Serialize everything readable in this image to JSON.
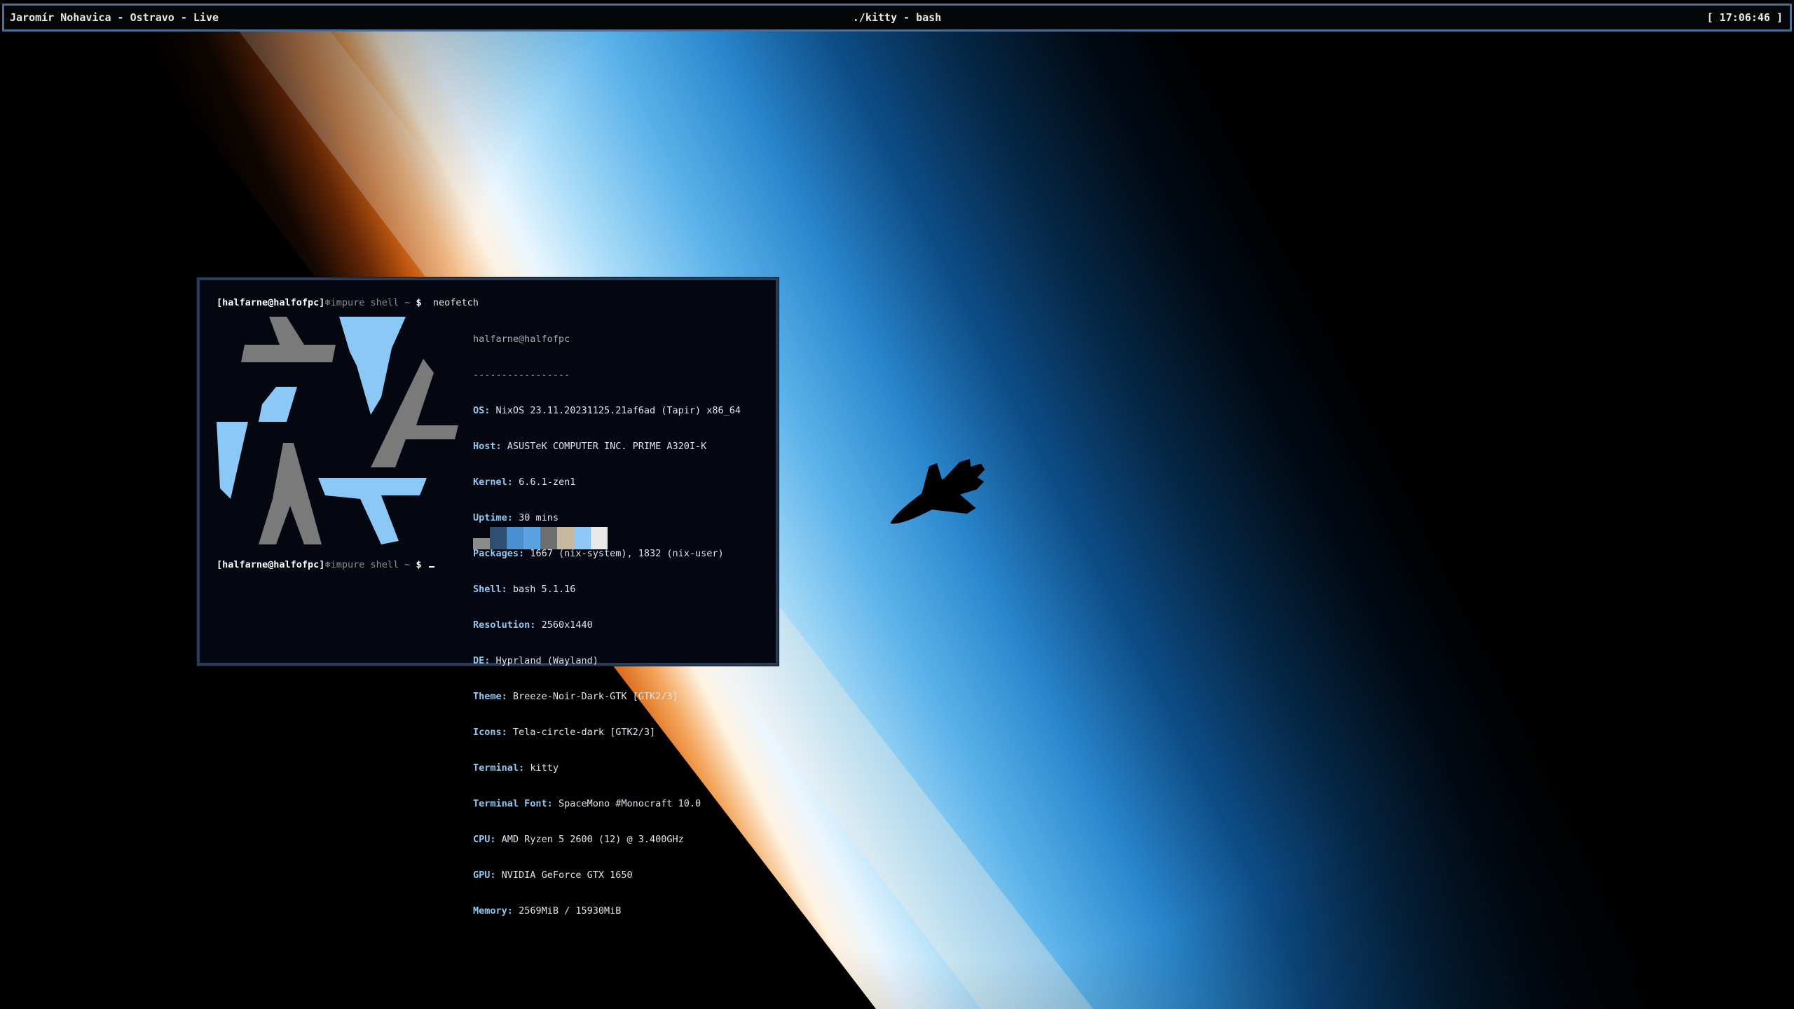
{
  "topbar": {
    "media": "Jaromír Nohavica - Ostravo - Live",
    "window_title": "./kitty - bash",
    "clock": "[ 17:06:46 ]"
  },
  "terminal": {
    "prompt1": {
      "user": "[halfarne@halfofpc]",
      "shell": "❄impure shell ~",
      "dollar": "$",
      "command": "neofetch"
    },
    "prompt2": {
      "user": "[halfarne@halfofpc]",
      "shell": "❄impure shell ~",
      "dollar": "$"
    },
    "neofetch": {
      "title": "halfarne@halfofpc",
      "separator": "-----------------",
      "fields": [
        {
          "key": "OS",
          "value": "NixOS 23.11.20231125.21af6ad (Tapir) x86_64"
        },
        {
          "key": "Host",
          "value": "ASUSTeK COMPUTER INC. PRIME A320I-K"
        },
        {
          "key": "Kernel",
          "value": "6.6.1-zen1"
        },
        {
          "key": "Uptime",
          "value": "30 mins"
        },
        {
          "key": "Packages",
          "value": "1667 (nix-system), 1832 (nix-user)"
        },
        {
          "key": "Shell",
          "value": "bash 5.1.16"
        },
        {
          "key": "Resolution",
          "value": "2560x1440"
        },
        {
          "key": "DE",
          "value": "Hyprland (Wayland)"
        },
        {
          "key": "Theme",
          "value": "Breeze-Noir-Dark-GTK [GTK2/3]"
        },
        {
          "key": "Icons",
          "value": "Tela-circle-dark [GTK2/3]"
        },
        {
          "key": "Terminal",
          "value": "kitty"
        },
        {
          "key": "Terminal Font",
          "value": "SpaceMono #Monocraft 10.0"
        },
        {
          "key": "CPU",
          "value": "AMD Ryzen 5 2600 (12) @ 3.400GHz"
        },
        {
          "key": "GPU",
          "value": "NVIDIA GeForce GTX 1650"
        },
        {
          "key": "Memory",
          "value": "2569MiB / 15930MiB"
        }
      ],
      "palette": [
        "#8a8a8a",
        "#2f4f70",
        "#4a8fd0",
        "#5ba3e0",
        "#6e6e6e",
        "#c9b8a0",
        "#90c8f5",
        "#e8e8e8"
      ],
      "logo_colors": {
        "grey": "#7a7a7a",
        "blue": "#8cc8f5"
      }
    }
  }
}
